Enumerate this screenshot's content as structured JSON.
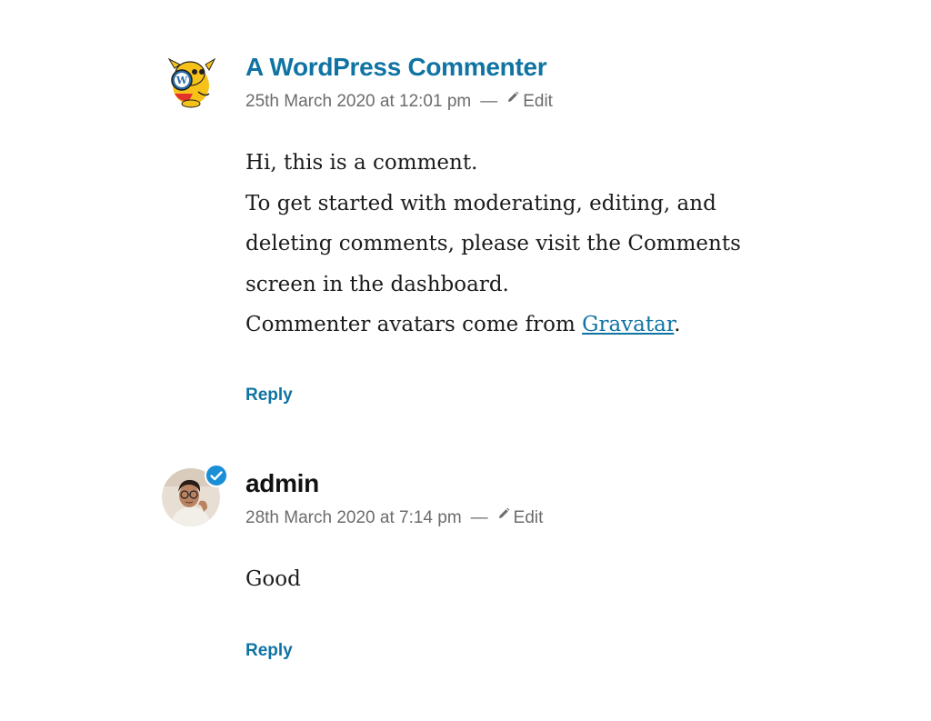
{
  "comments": [
    {
      "author": "A WordPress Commenter",
      "author_is_link": true,
      "date": "25th March 2020 at 12:01 pm",
      "separator": "—",
      "edit_label": "Edit",
      "paragraphs": [
        "Hi, this is a comment.",
        "To get started with moderating, editing, and deleting comments, please visit the Comments screen in the dashboard."
      ],
      "last_line_prefix": "Commenter avatars come from ",
      "last_line_link": "Gravatar",
      "last_line_suffix": ".",
      "reply_label": "Reply",
      "avatar": "wapuu-avatar-icon"
    },
    {
      "author": "admin",
      "author_is_link": false,
      "date": "28th March 2020 at 7:14 pm",
      "separator": "—",
      "edit_label": "Edit",
      "paragraphs": [
        "Good"
      ],
      "reply_label": "Reply",
      "avatar": "user-photo-avatar",
      "badge": "verified-check-icon"
    }
  ],
  "colors": {
    "link": "#0f73a3",
    "meta": "#6c6c6c",
    "text": "#1c1c1c",
    "badge": "#1a8fd6"
  }
}
